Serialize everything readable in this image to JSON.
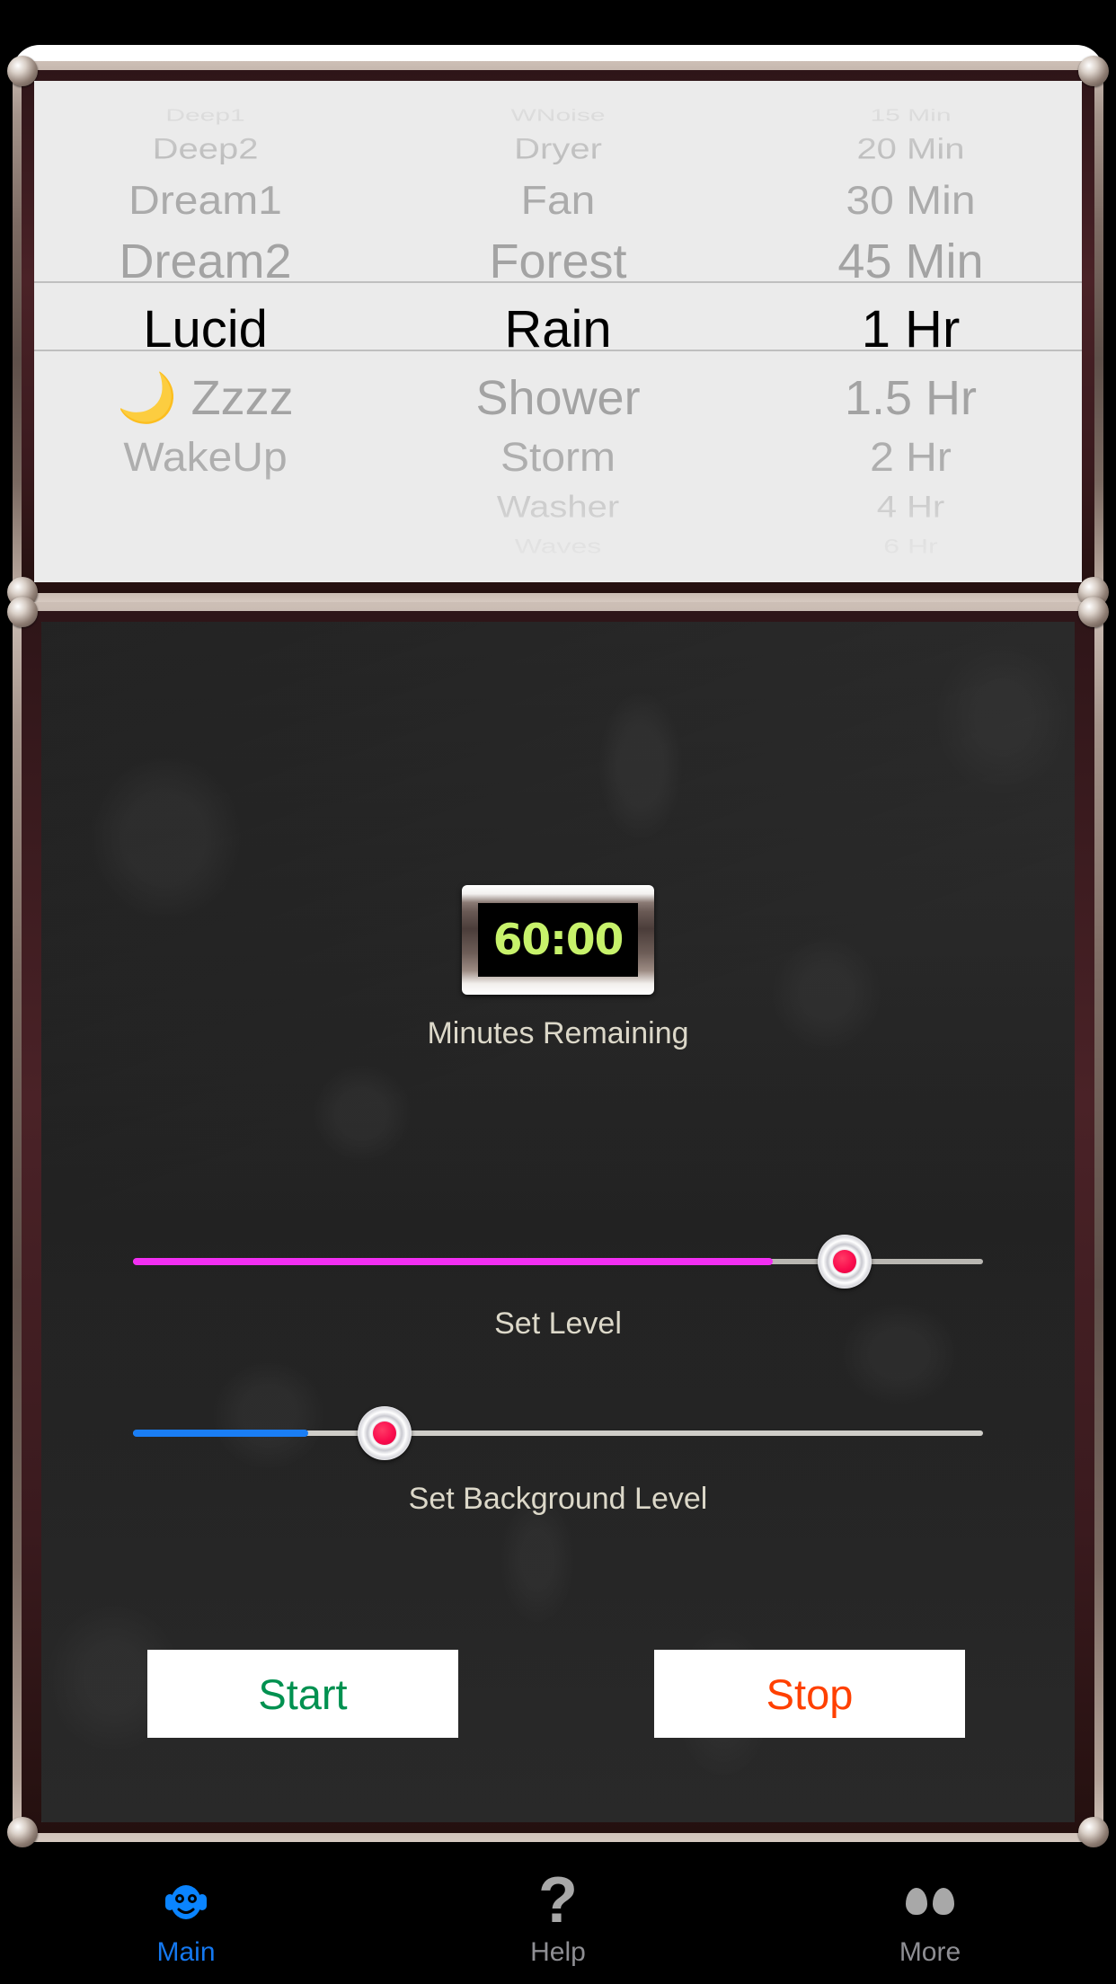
{
  "app": {
    "theme_accent": "#1478f0",
    "panel_label_color": "#dcd8c9"
  },
  "picker": {
    "columns": [
      {
        "name": "program",
        "selected": "Lucid",
        "items": [
          "Deep1",
          "Deep2",
          "Dream1",
          "Dream2",
          "Lucid",
          "🌙 Zzzz",
          "WakeUp"
        ]
      },
      {
        "name": "sound",
        "selected": "Rain",
        "items": [
          "WNoise",
          "Dryer",
          "Fan",
          "Forest",
          "Rain",
          "Shower",
          "Storm",
          "Washer",
          "Waves"
        ]
      },
      {
        "name": "duration",
        "selected": "1 Hr",
        "items": [
          "15 Min",
          "20 Min",
          "30 Min",
          "45 Min",
          "1 Hr",
          "1.5 Hr",
          "2 Hr",
          "4 Hr",
          "6 Hr"
        ]
      }
    ]
  },
  "timer": {
    "value": "60:00",
    "digit_color": "#c7f26b",
    "caption": "Minutes Remaining"
  },
  "sliders": {
    "level": {
      "label": "Set Level",
      "fill_color": "#f22ff2",
      "percent": 75
    },
    "background": {
      "label": "Set Background Level",
      "fill_color": "#1a7ef5",
      "percent": 21
    }
  },
  "buttons": {
    "start": {
      "label": "Start",
      "color": "#009150"
    },
    "stop": {
      "label": "Stop",
      "color": "#ff4000"
    }
  },
  "tabbar": {
    "tabs": [
      {
        "label": "Main",
        "icon": "headphones-face-icon",
        "active": true
      },
      {
        "label": "Help",
        "icon": "question-mark-icon",
        "active": false
      },
      {
        "label": "More",
        "icon": "more-dots-icon",
        "active": false
      }
    ]
  }
}
